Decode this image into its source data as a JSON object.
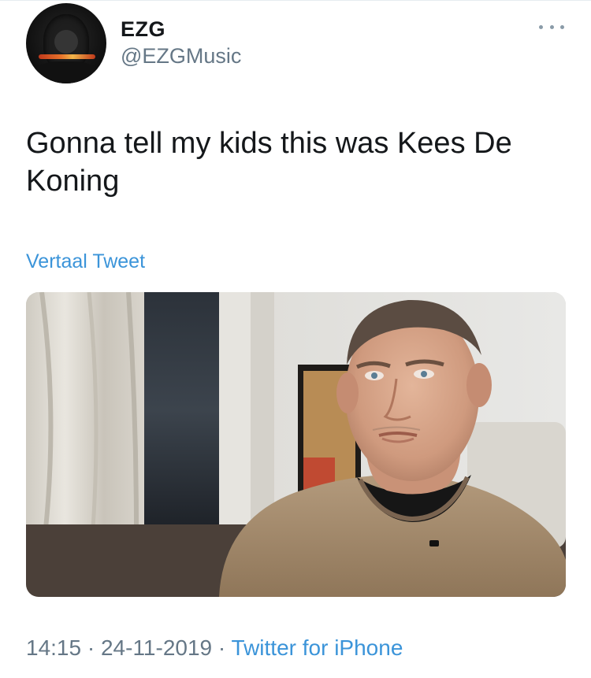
{
  "author": {
    "name": "EZG",
    "handle": "@EZGMusic",
    "avatar_icon": "hooded-figure-avatar"
  },
  "tweet": {
    "text": "Gonna tell my kids this was Kees De Koning",
    "translate_label": "Vertaal Tweet",
    "media_icon": "photo-man-in-sweater"
  },
  "meta": {
    "time": "14:15",
    "date": "24-11-2019",
    "separator": "·",
    "source": "Twitter for iPhone"
  },
  "more_icon": "more-horizontal-icon",
  "colors": {
    "text": "#14171a",
    "secondary": "#657786",
    "link": "#3b94d9"
  }
}
